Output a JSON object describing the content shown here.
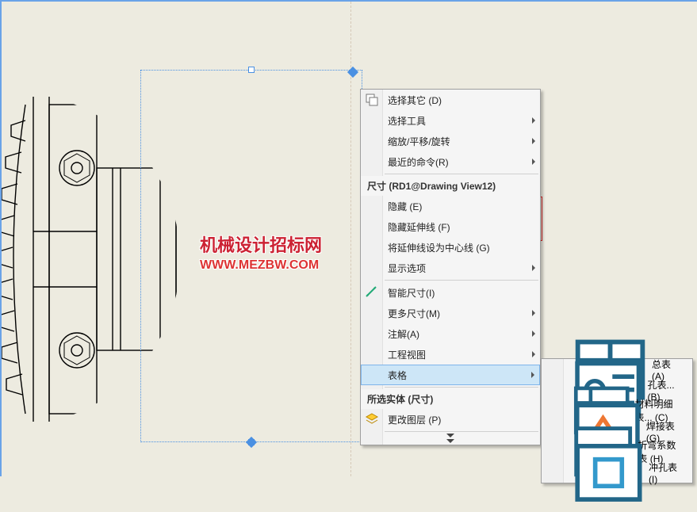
{
  "watermark": {
    "line1": "机械设计招标网",
    "line2": "WWW.MEZBW.COM"
  },
  "menu": {
    "select_other": "选择其它 (D)",
    "select_tools": "选择工具",
    "zoom_pan_rotate": "缩放/平移/旋转",
    "recent_commands": "最近的命令(R)",
    "section_dim": "尺寸 (RD1@Drawing View12)",
    "hide": "隐藏 (E)",
    "hide_ext_lines": "隐藏延伸线 (F)",
    "ext_as_center": "将延伸线设为中心线 (G)",
    "display_options": "显示选项",
    "smart_dim": "智能尺寸(I)",
    "more_dims": "更多尺寸(M)",
    "annotations": "注解(A)",
    "drawing_views": "工程视图",
    "tables": "表格",
    "section_selected": "所选实体 (尺寸)",
    "change_layer": "更改图层 (P)"
  },
  "submenu": {
    "general_table": "总表 (A)",
    "hole_table": "孔表... (B)",
    "bom": "材料明细表... (C)",
    "weld_table": "焊接表 (G)",
    "bend_table": "折弯系数表 (H)",
    "punch_table": "冲孔表 (I)"
  }
}
